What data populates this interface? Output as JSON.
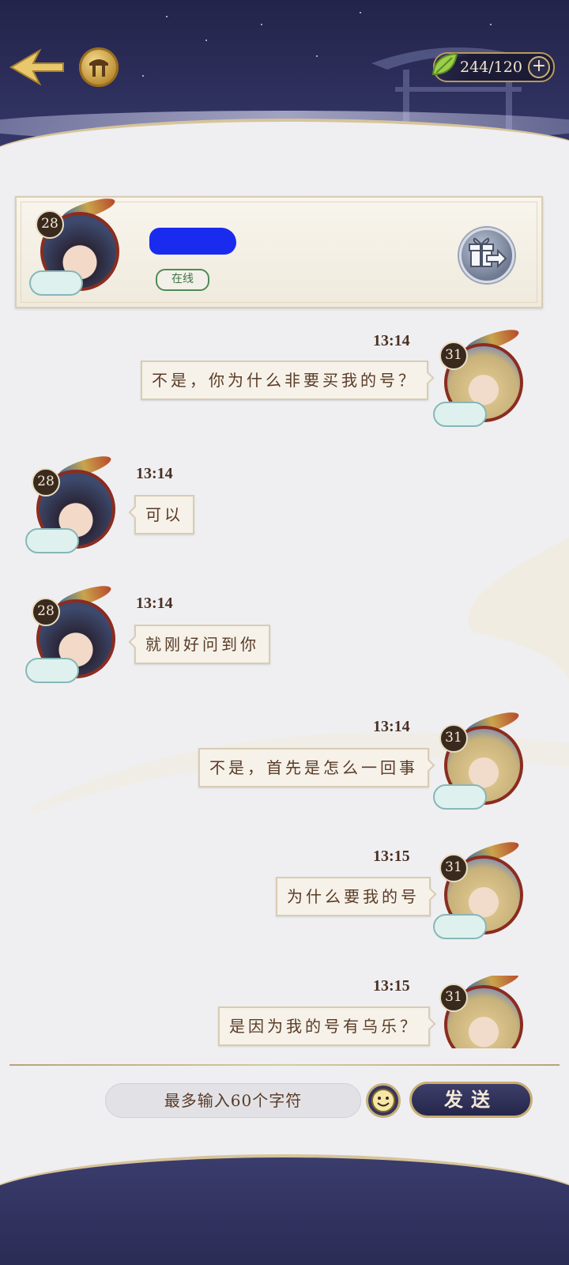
{
  "header": {
    "currency_value": "244/120",
    "plus_label": "+"
  },
  "profile": {
    "level": "28",
    "name": "",
    "status": "在线"
  },
  "messages": [
    {
      "side": "right",
      "time": "13:14",
      "text": "不是，你为什么非要买我的号？",
      "level": "31"
    },
    {
      "side": "left",
      "time": "13:14",
      "text": "可以",
      "level": "28"
    },
    {
      "side": "left",
      "time": "13:14",
      "text": "就刚好问到你",
      "level": "28"
    },
    {
      "side": "right",
      "time": "13:14",
      "text": "不是，首先是怎么一回事",
      "level": "31"
    },
    {
      "side": "right",
      "time": "13:15",
      "text": "为什么要我的号",
      "level": "31"
    },
    {
      "side": "right",
      "time": "13:15",
      "text": "是因为我的号有乌乐？",
      "level": "31"
    }
  ],
  "input": {
    "placeholder": "最多输入60个字符"
  },
  "send_label": "发送",
  "colors": {
    "header_bg": "#23244a",
    "accent_gold": "#c9ae74",
    "bubble_bg": "#f6f2e9",
    "text_brown": "#5a3a26",
    "online_green": "#4f8a56"
  },
  "icons": {
    "back": "back-arrow-icon",
    "home": "home-icon",
    "currency": "leaf-icon",
    "gift": "gift-icon",
    "emoji": "smiley-icon"
  }
}
